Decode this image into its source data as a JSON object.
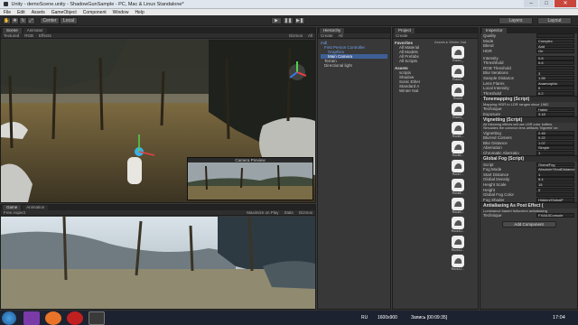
{
  "window": {
    "title": "Unity - demoScene.unity - ShadowGunSample - PC, Mac & Linux Standalone*"
  },
  "menu": [
    "File",
    "Edit",
    "Assets",
    "GameObject",
    "Component",
    "Window",
    "Help"
  ],
  "toolbar": {
    "pivot": "Center",
    "space": "Local",
    "layers": "Layers",
    "layout": "Layout"
  },
  "scene": {
    "tab_scene": "Scene",
    "tab_animator": "Animator",
    "shading": "Textured",
    "mode": "RGB",
    "effects": "Effects",
    "gizmos": "Gizmos",
    "search": "All",
    "camera_preview": "Camera Preview"
  },
  "game": {
    "tab_game": "Game",
    "tab_animation": "Animation",
    "aspect": "Free Aspect",
    "maximize": "Maximize on Play",
    "stats": "Stats",
    "gizmos": "Gizmos"
  },
  "hierarchy": {
    "tab": "Hierarchy",
    "create": "Create",
    "search": "All",
    "items": [
      "mdl",
      "First Person Controller",
      "Graphics",
      "Main Camera",
      "Terrain",
      "Directional light"
    ]
  },
  "project": {
    "tab": "Project",
    "create": "Create",
    "favorites": "Favorites",
    "fav_items": [
      "All Material",
      "All Models",
      "All Prefabs",
      "All Scripts"
    ],
    "assets": "Assets",
    "asset_items": [
      "scripts",
      "Shadow",
      "Sonic Ether",
      "Standard A",
      "Winter Nat"
    ],
    "breadcrumb": "Assets ▸ Winter Nat",
    "thumbs": [
      "Rock1_",
      "Rock2_",
      "Rock3",
      "Rock4_",
      "Rock5...",
      "Rock6...",
      "Rock7...",
      "Rock8...",
      "Rock9...",
      "Rock10...",
      "Rock11...",
      "Rock12..."
    ]
  },
  "inspector": {
    "tab": "Inspector",
    "top_rows": [
      {
        "label": "Quality",
        "value": ""
      },
      {
        "label": "Mode",
        "value": "Complex"
      },
      {
        "label": "Blend",
        "value": "Add"
      },
      {
        "label": "HDR",
        "value": "On"
      }
    ],
    "bloom_rows": [
      {
        "label": "Intensity",
        "value": "0.8"
      },
      {
        "label": "Threshhold",
        "value": "0.6"
      },
      {
        "label": "RGB Threshold",
        "value": ""
      },
      {
        "label": "Blur Iterations",
        "value": "3"
      },
      {
        "label": "Sample Distance",
        "value": "1.55"
      },
      {
        "label": "Lens Flares",
        "value": "Anamorphic"
      },
      {
        "label": "Local Intensity",
        "value": "0"
      },
      {
        "label": "Threshold",
        "value": "0.2"
      }
    ],
    "tonemapping": {
      "title": "Tonemapping (Script)",
      "note": "Mapping HDR to LDR ranges since 1982",
      "technique_label": "Technique",
      "technique": "Hable",
      "exposure_label": "Exposure",
      "exposure": "3.18"
    },
    "vignetting": {
      "title": "Vignetting (Script)",
      "note1": "All following effects will use LDR color buffers",
      "note2": "Simulates the common lens artifacts 'Vignette' an",
      "rows": [
        {
          "label": "Vignetting",
          "value": "2.45"
        },
        {
          "label": "Blurred Corners",
          "value": "0.22"
        },
        {
          "label": "Blur Distance",
          "value": "1.07"
        },
        {
          "label": "Aberration",
          "value": "Simple"
        },
        {
          "label": "Chromatic Aberratio",
          "value": "1"
        }
      ]
    },
    "fog": {
      "title": "Global Fog (Script)",
      "rows": [
        {
          "label": "Script",
          "value": "GlobalFog"
        },
        {
          "label": "Fog Mode",
          "value": "AbsoluteYAndDistance"
        },
        {
          "label": "Start Distance",
          "value": "1"
        },
        {
          "label": "Global Density",
          "value": "8.4"
        },
        {
          "label": "Height Scale",
          "value": "15"
        },
        {
          "label": "Height",
          "value": "0"
        },
        {
          "label": "Global Fog Color",
          "value": ""
        },
        {
          "label": "Fog Shader",
          "value": "Hidden/GlobalF"
        }
      ]
    },
    "aa": {
      "title": "Antialiasing As Post Effect (",
      "note": "Luminance based fullscreen antialiasing",
      "technique_label": "Technique",
      "technique": "FXAA3Console"
    },
    "add_component": "Add Component"
  },
  "taskbar": {
    "lang": "RU",
    "resolution": "1600x900",
    "recording": "Запись [00:09:35]",
    "time": "17:04"
  },
  "colors": {
    "accent": "#3b6ea8",
    "selection": "#3e5f96",
    "titlebar": "#dfe6ee"
  }
}
